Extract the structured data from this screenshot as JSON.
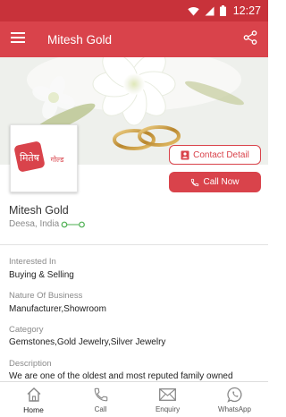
{
  "status_bar": {
    "time": "12:27"
  },
  "app_bar": {
    "title": "Mitesh Gold"
  },
  "logo": {
    "brand_text": "मितेष",
    "brand_sub": "गोल्ड"
  },
  "actions": {
    "contact_label": "Contact Detail",
    "call_label": "Call Now"
  },
  "business": {
    "name": "Mitesh Gold",
    "location": "Deesa, India"
  },
  "sections": [
    {
      "label": "Interested In",
      "value": "Buying & Selling"
    },
    {
      "label": "Nature Of Business",
      "value": "Manufacturer,Showroom"
    },
    {
      "label": "Category",
      "value": "Gemstones,Gold Jewelry,Silver Jewelry"
    },
    {
      "label": "Description",
      "value": "We are one of the oldest and most reputed family owned"
    }
  ],
  "bottom_nav": [
    {
      "label": "Home",
      "icon": "home-icon"
    },
    {
      "label": "Call",
      "icon": "phone-icon"
    },
    {
      "label": "Enquiry",
      "icon": "mail-icon"
    },
    {
      "label": "WhatsApp",
      "icon": "whatsapp-icon"
    }
  ],
  "colors": {
    "primary": "#d9434b",
    "status_bar": "#c8323a",
    "accent_green": "#4caf50"
  }
}
